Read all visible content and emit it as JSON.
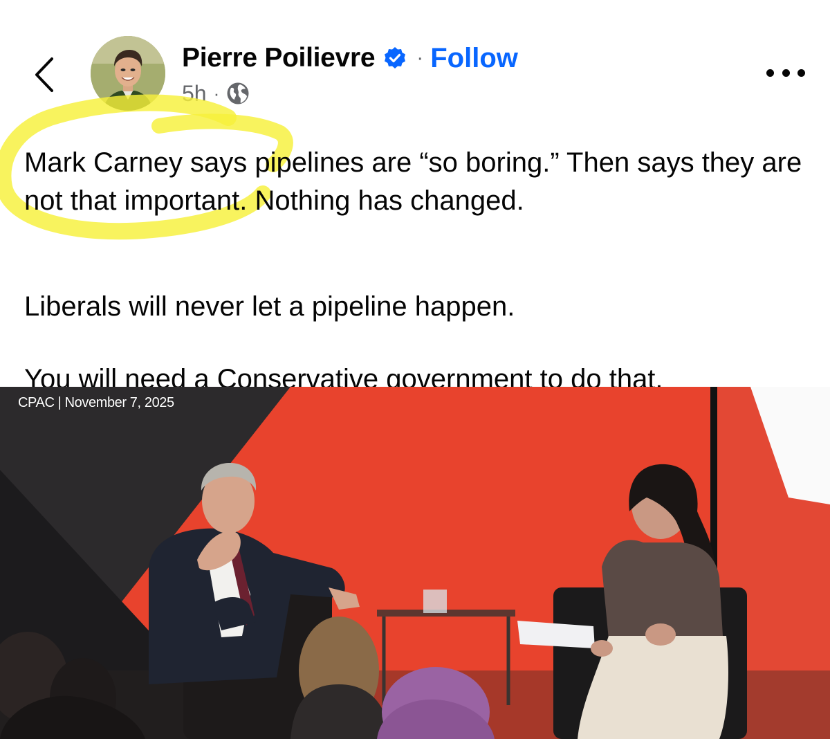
{
  "post": {
    "author": "Pierre Poilievre",
    "follow_label": "Follow",
    "timestamp": "5h",
    "paragraphs": [
      "Mark Carney says pipelines are “so boring.” Then says they are not that important. Nothing has changed.",
      "Liberals will never let a pipeline happen.",
      "You will need a Conservative government to do that."
    ]
  },
  "media": {
    "caption_source": "CPAC",
    "caption_date": "November 7, 2025"
  },
  "icons": {
    "back": "chevron-left-icon",
    "verified": "verified-badge-icon",
    "privacy": "globe-icon",
    "more": "more-horizontal-icon"
  },
  "colors": {
    "link_blue": "#0866ff",
    "secondary_text": "#65676b",
    "highlight": "#f6f03a",
    "stage_red": "#e8432d"
  }
}
